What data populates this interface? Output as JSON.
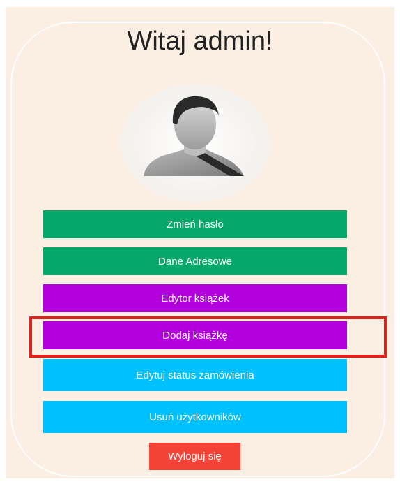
{
  "header": {
    "title": "Witaj admin!"
  },
  "avatar": {
    "icon": "user-avatar-icon"
  },
  "menu": {
    "change_password": "Zmień hasło",
    "address_data": "Dane Adresowe",
    "book_editor": "Edytor książek",
    "add_book": "Dodaj książkę",
    "order_status": "Edytuj status zamówienia",
    "delete_users": "Usuń użytkowników"
  },
  "logout": {
    "label": "Wyloguj się"
  },
  "colors": {
    "background": "#fbeee2",
    "green": "#05a86a",
    "purple": "#b200dc",
    "cyan": "#00c1ff",
    "logout_red": "#f44336",
    "highlight_red": "#e0221f"
  }
}
